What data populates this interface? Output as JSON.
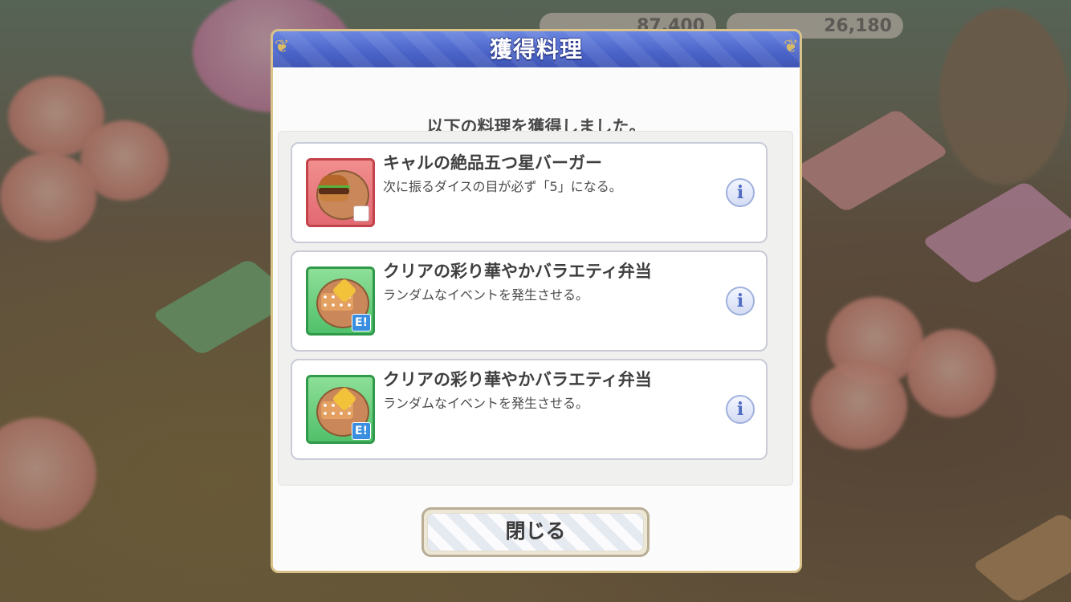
{
  "hud": {
    "stat_left": "87,400",
    "stat_right": "26,180"
  },
  "dialog": {
    "title": "獲得料理",
    "subtitle": "以下の料理を獲得しました。",
    "items": [
      {
        "name": "キャルの絶品五つ星バーガー",
        "description": "次に振るダイスの目が必ず「5」になる。",
        "icon": "burger-dish-icon"
      },
      {
        "name": "クリアの彩り華やかバラエティ弁当",
        "description": "ランダムなイベントを発生させる。",
        "icon": "bento-dish-icon"
      },
      {
        "name": "クリアの彩り華やかバラエティ弁当",
        "description": "ランダムなイベントを発生させる。",
        "icon": "bento-dish-icon"
      }
    ],
    "info_glyph": "i",
    "badge_text": "E!",
    "close_label": "閉じる"
  },
  "colors": {
    "title_bar": "#4a63c8",
    "frame_gold": "#d9c38a",
    "icon_red": "#e26a72",
    "icon_green": "#51c06b"
  }
}
